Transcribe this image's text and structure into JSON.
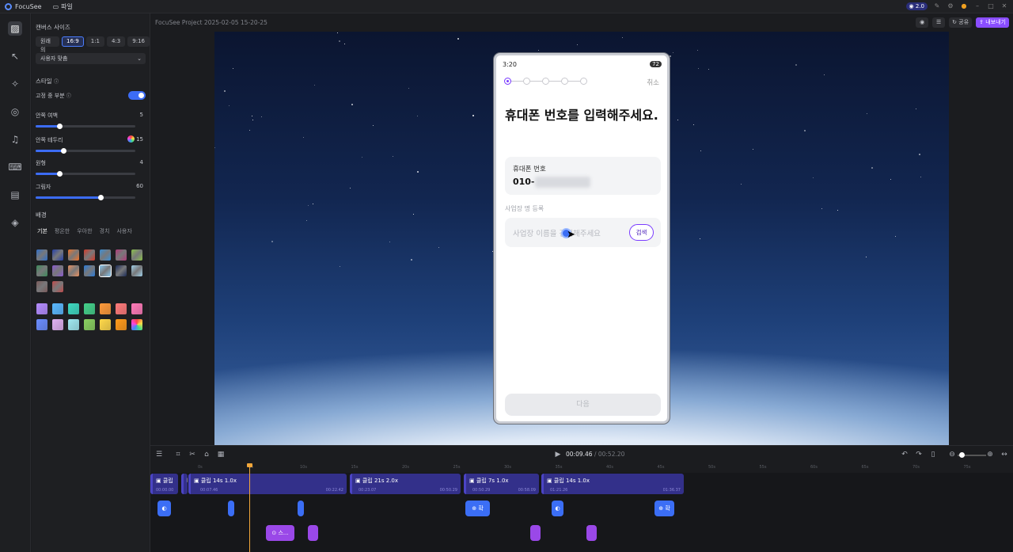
{
  "app": {
    "name": "FocuSee",
    "file_menu": "파일",
    "version_badge": "2.0"
  },
  "canvas_panel": {
    "title": "캔버스 사이즈",
    "ratios": [
      "원래의",
      "16:9",
      "1:1",
      "4:3",
      "9:16"
    ],
    "selected_ratio": "16:9",
    "size_dropdown": "사용자 맞춤",
    "style_title": "스타일",
    "fixed_label": "고정 중 부분",
    "fixed_on": true,
    "sliders": [
      {
        "label": "안쪽 여백",
        "value": "5",
        "fraction": 0.24
      },
      {
        "label": "안쪽 테두리",
        "value": "15",
        "fraction": 0.28
      },
      {
        "label": "원형",
        "value": "4",
        "fraction": 0.24
      },
      {
        "label": "그림자",
        "value": "60",
        "fraction": 0.65
      }
    ],
    "background_title": "배경",
    "bg_tabs": [
      "기본",
      "평온한",
      "우아한",
      "경치",
      "사용자"
    ],
    "image_swatches": [
      "#2f6fc9",
      "#2540a8",
      "#f0732a",
      "#d33a2a",
      "#3a8fd8",
      "#b03a7a",
      "#8ac04a",
      "#3c8a5a",
      "#8a5acf",
      "#e89060",
      "#2a7ad8",
      "#88c8f0",
      "#1b2a55",
      "#9fd0e8",
      "#7a5a5a",
      "#c04a4a"
    ],
    "color_swatches": [
      "#b48cff",
      "#5ab8ff",
      "#3ed8c0",
      "#44d08a",
      "#ff9a3a",
      "#ff7a7a",
      "#ff7ab8",
      "#6a8cff",
      "#e0b0f0",
      "#a0e8f0",
      "#8ad060",
      "#ffd84a",
      "#ff9a1a",
      "#ff5a8a"
    ]
  },
  "project": {
    "title": "FocuSee Project 2025-02-05 15-20-25",
    "share": "공유",
    "export": "내보내기"
  },
  "phone": {
    "time": "3:20",
    "battery": "72",
    "cancel": "취소",
    "title": "휴대폰 번호를 입력해주세요.",
    "phone_label": "휴대폰 번호",
    "phone_value": "010-",
    "business_label": "사업장 명 등록",
    "search_placeholder": "사업장 이름을 검색해주세요",
    "search_button": "검색",
    "next_button": "다음"
  },
  "timeline": {
    "current": "00:09.46",
    "total": "00:52.20",
    "ruler": [
      "0s",
      "5s",
      "10s",
      "15s",
      "20s",
      "25s",
      "30s",
      "35s",
      "40s",
      "45s",
      "50s",
      "55s",
      "60s",
      "65s",
      "70s",
      "75s",
      "80s"
    ],
    "clips": [
      {
        "label": "클립",
        "times": [
          "00:00.00",
          "00:07.46"
        ]
      },
      {
        "label": "클립  14s  1.0x",
        "times": [
          "00:07.46",
          "00:22.42"
        ]
      },
      {
        "label": "클립  21s  2.0x",
        "times": [
          "00:23.07",
          "00:50.29"
        ]
      },
      {
        "label": "클립  7s  1.0x",
        "times": [
          "00:50.29",
          "00:58.09"
        ]
      },
      {
        "label": "클립  14s  1.0x",
        "times": [
          "01:21.26",
          "01:36.37"
        ]
      }
    ],
    "zoom_blocks": [
      "확",
      "확"
    ],
    "p_block": "스..."
  }
}
